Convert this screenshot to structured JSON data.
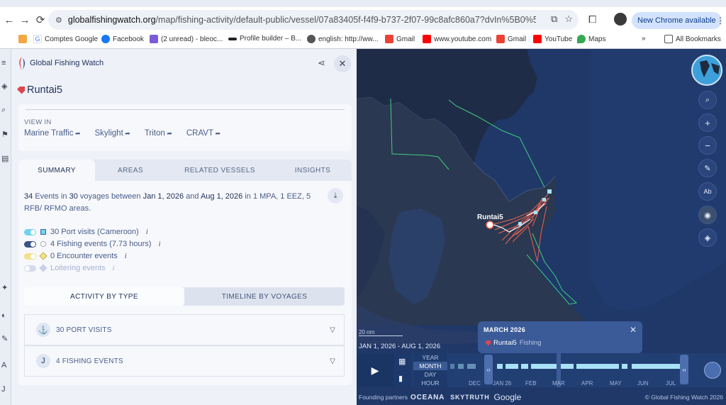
{
  "browser": {
    "url_domain": "globalfishingwatch.org",
    "url_path": "/map/fishing-activity/default-public/vessel/07a83405f-f4f9-b737-2f07-99c8afc860a7?dvIn%5B0%5D%5Bcfg%5...",
    "new_chrome_label": "New Chrome available",
    "bookmarks": [
      "Comptes Google",
      "Facebook",
      "(2 unread) - bleoc...",
      "Profile builder – B...",
      "english: http://ww...",
      "Gmail",
      "www.youtube.com",
      "Gmail",
      "YouTube",
      "Maps",
      "All Bookmarks"
    ]
  },
  "panel": {
    "app_title": "Global Fishing Watch",
    "vessel_name": "Runtai5",
    "view_in_label": "VIEW IN",
    "view_links": [
      "Marine Traffic",
      "Skylight",
      "Triton",
      "CRAVT"
    ],
    "tabs": [
      "SUMMARY",
      "AREAS",
      "RELATED VESSELS",
      "INSIGHTS"
    ],
    "summary": {
      "events": "34",
      "text1": " Events in ",
      "voyages": "30",
      "text2": " voyages between ",
      "start": "Jan 1, 2026",
      "text3": " and ",
      "end": "Aug 1, 2026",
      "text4": " in 1 MPA, 1 EEZ, 5 RFB/ RFMO areas."
    },
    "event_types": [
      {
        "label": "30 Port visits (Cameroon)",
        "color": "#6fd3f0",
        "on": true
      },
      {
        "label": "4 Fishing events (7.73 hours)",
        "color": "#3a5488",
        "on": true
      },
      {
        "label": "0 Encounter events",
        "color": "#f3e08a",
        "on": true
      },
      {
        "label": "Loitering events",
        "color": "#c9cfe6",
        "on": false
      }
    ],
    "info_glyph": "i",
    "subtabs": [
      "ACTIVITY BY TYPE",
      "TIMELINE BY VOYAGES"
    ],
    "accordions": [
      "30 PORT VISITS",
      "4 FISHING EVENTS"
    ]
  },
  "map": {
    "vessel_label": "Runtai5",
    "scale_label": "20 nm",
    "date_range": "JAN 1, 2026 - AUG 1, 2026",
    "popup": {
      "title": "MARCH 2026",
      "vessel": "Runtai5",
      "event": "Fishing"
    },
    "time_resolutions": [
      "YEAR",
      "MONTH",
      "DAY",
      "HOUR"
    ],
    "active_resolution": "MONTH",
    "months": [
      "DEC",
      "JAN 26",
      "FEB",
      "MAR",
      "APR",
      "MAY",
      "JUN",
      "JUL"
    ],
    "footer_label": "Founding partners",
    "partners": [
      "OCEANA",
      "SKYTRUTH",
      "Google"
    ],
    "copyright": "© Global Fishing Watch 2026",
    "colors": {
      "track": "#e8624f",
      "eez_line": "#3fce7a",
      "land": "#1c2a44",
      "ocean": "#213b6e"
    }
  }
}
